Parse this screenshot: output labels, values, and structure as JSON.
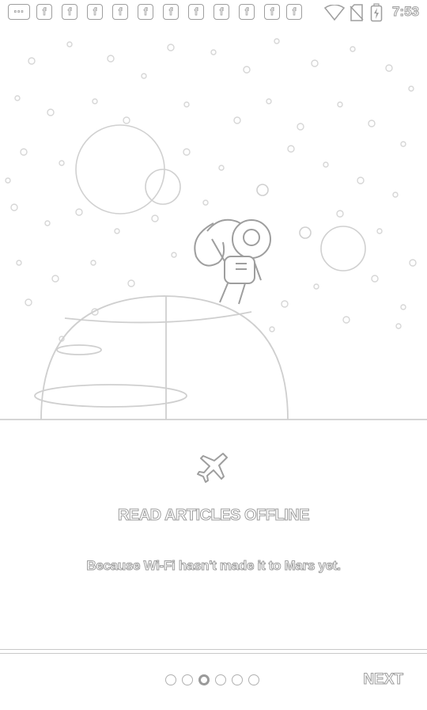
{
  "status_bar": {
    "time": "7:53",
    "notification_icons": [
      "more-notifications-icon",
      "facebook-icon",
      "facebook-icon",
      "facebook-icon",
      "facebook-icon",
      "facebook-icon",
      "facebook-icon",
      "facebook-icon",
      "facebook-icon",
      "facebook-icon",
      "facebook-icon",
      "facebook-icon"
    ],
    "system_icons": [
      "wifi-icon",
      "no-sim-icon",
      "battery-charging-icon"
    ]
  },
  "onboarding": {
    "illustration": "astronaut-floating-above-planet",
    "feature_icon": "airplane-icon",
    "title": "READ ARTICLES OFFLINE",
    "subtitle": "Because Wi-Fi hasn't made it to Mars yet."
  },
  "pager": {
    "page_count": 6,
    "active_index": 2
  },
  "footer": {
    "next_label": "NEXT"
  }
}
